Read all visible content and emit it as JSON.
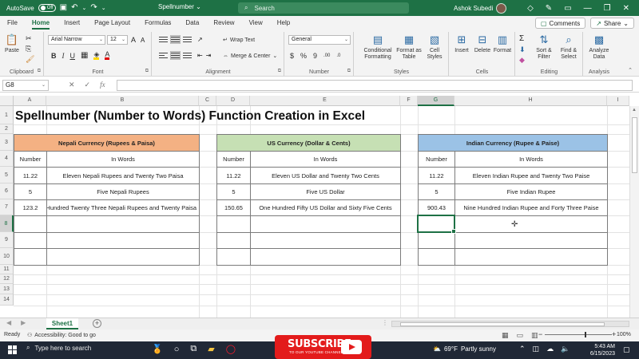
{
  "titlebar": {
    "autosave_label": "AutoSave",
    "autosave_state": "Off",
    "filename": "Spellnumber",
    "filename_arrow": "⌄",
    "search_placeholder": "Search",
    "user_name": "Ashok Subedi"
  },
  "ribbon_tabs": [
    "File",
    "Home",
    "Insert",
    "Page Layout",
    "Formulas",
    "Data",
    "Review",
    "View",
    "Help"
  ],
  "active_tab": "Home",
  "comments_label": "Comments",
  "share_label": "Share",
  "ribbon": {
    "clipboard": {
      "paste": "Paste",
      "label": "Clipboard"
    },
    "font": {
      "name": "Arial Narrow",
      "size": "12",
      "label": "Font"
    },
    "alignment": {
      "wrap": "Wrap Text",
      "merge": "Merge & Center",
      "label": "Alignment"
    },
    "number": {
      "format": "General",
      "label": "Number"
    },
    "styles": {
      "conditional": "Conditional Formatting",
      "format_table": "Format as Table",
      "cell_styles": "Cell Styles",
      "label": "Styles"
    },
    "cells": {
      "insert": "Insert",
      "delete": "Delete",
      "format": "Format",
      "label": "Cells"
    },
    "editing": {
      "sort": "Sort & Filter",
      "find": "Find & Select",
      "label": "Editing"
    },
    "analysis": {
      "analyze": "Analyze Data",
      "label": "Analysis"
    }
  },
  "formula_bar": {
    "name_box": "G8",
    "value": ""
  },
  "columns": [
    "A",
    "B",
    "C",
    "D",
    "E",
    "F",
    "G",
    "H",
    "I"
  ],
  "selected_column": "G",
  "rows": [
    "1",
    "2",
    "3",
    "4",
    "5",
    "6",
    "7",
    "8",
    "9",
    "10",
    "11",
    "12",
    "13",
    "14"
  ],
  "selected_row": "8",
  "sheet_title": "Spellnumber (Number to Words) Function Creation in Excel",
  "tables": [
    {
      "header": "Nepali Currency (Rupees & Paisa)",
      "header_color": "#f4b183",
      "col_number": "Number",
      "col_words": "In Words",
      "rows": [
        {
          "number": "11.22",
          "words": "Eleven Nepali Rupees and Twenty Two Paisa"
        },
        {
          "number": "5",
          "words": "Five Nepali Rupees"
        },
        {
          "number": "123.2",
          "words": "e Hundred Twenty Three Nepali Rupees and Twenty  Paisa"
        }
      ]
    },
    {
      "header": "US Currency (Dollar & Cents)",
      "header_color": "#c6e0b4",
      "col_number": "Number",
      "col_words": "In Words",
      "rows": [
        {
          "number": "11.22",
          "words": "Eleven US Dollar and Twenty Two Cents"
        },
        {
          "number": "5",
          "words": "Five US Dollar"
        },
        {
          "number": "150.65",
          "words": "One Hundred Fifty  US Dollar and Sixty Five Cents"
        }
      ]
    },
    {
      "header": "Indian Currency (Rupee & Paise)",
      "header_color": "#9bc2e6",
      "col_number": "Number",
      "col_words": "In Words",
      "rows": [
        {
          "number": "11.22",
          "words": "Eleven Indian Rupee and Twenty Two Paise"
        },
        {
          "number": "5",
          "words": "Five Indian Rupee"
        },
        {
          "number": "900.43",
          "words": "Nine Hundred  Indian Rupee and Forty Three Paise"
        }
      ]
    }
  ],
  "sheet_tab": "Sheet1",
  "status": {
    "ready": "Ready",
    "accessibility": "Accessibility: Good to go",
    "zoom": "100%"
  },
  "taskbar": {
    "search": "Type here to search",
    "subscribe": "SUBSCRIBE",
    "subscribe_sub": "TO OUR YOUTUBE CHANNEL!",
    "temperature": "69°F",
    "weather": "Partly sunny",
    "time": "5:43 AM",
    "date": "6/15/2023"
  },
  "colors": {
    "excel_green": "#1e7145",
    "taskbar": "#202836",
    "subscribe_red": "#e31b1b"
  }
}
